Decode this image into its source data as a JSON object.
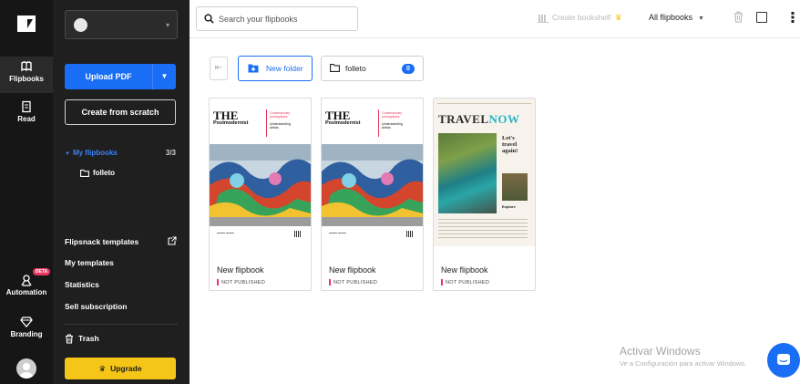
{
  "rail": {
    "items": [
      {
        "label": "Flipbooks",
        "icon": "flipbooks-icon"
      },
      {
        "label": "Read",
        "icon": "read-icon"
      },
      {
        "label": "Automation",
        "icon": "automation-icon",
        "badge": "BETA"
      },
      {
        "label": "Branding",
        "icon": "diamond-icon"
      }
    ]
  },
  "sidebar": {
    "upload_label": "Upload PDF",
    "scratch_label": "Create from scratch",
    "my_flipbooks": {
      "label": "My flipbooks",
      "count": "3/3"
    },
    "folder": "folleto",
    "links": [
      "Flipsnack templates",
      "My templates",
      "Statistics",
      "Sell subscription"
    ],
    "trash": "Trash",
    "upgrade": "Upgrade"
  },
  "topbar": {
    "search_placeholder": "Search your flipbooks",
    "create_shelf": "Create bookshelf",
    "filter": "All flipbooks"
  },
  "toolbar": {
    "back_icon": "⇤",
    "new_folder": "New folder",
    "folder_name": "folleto",
    "folder_count": "0"
  },
  "cards": [
    {
      "title": "New flipbook",
      "status": "NOT PUBLISHED",
      "cover": {
        "the": "THE",
        "sub": "Postmodernist",
        "notes": [
          "Contemporary",
          "photographs",
          "",
          "Understanding",
          "Artists"
        ]
      }
    },
    {
      "title": "New flipbook",
      "status": "NOT PUBLISHED",
      "cover": {
        "the": "THE",
        "sub": "Postmodernist",
        "notes": [
          "Contemporary",
          "photographs",
          "",
          "Understanding",
          "Artists"
        ]
      }
    },
    {
      "title": "New flipbook",
      "status": "NOT PUBLISHED",
      "cover": {
        "title_a": "TRAVEL",
        "title_b": "NOW",
        "lets": [
          "Let's",
          "travel",
          "again!"
        ],
        "explore": "Explore"
      }
    }
  ],
  "watermark": {
    "line1": "Activar Windows",
    "line2": "Ve a Configuración para activar Windows."
  },
  "colors": {
    "accent": "#1a6ef5",
    "upgrade": "#f5c518",
    "status": "#e8365d"
  }
}
